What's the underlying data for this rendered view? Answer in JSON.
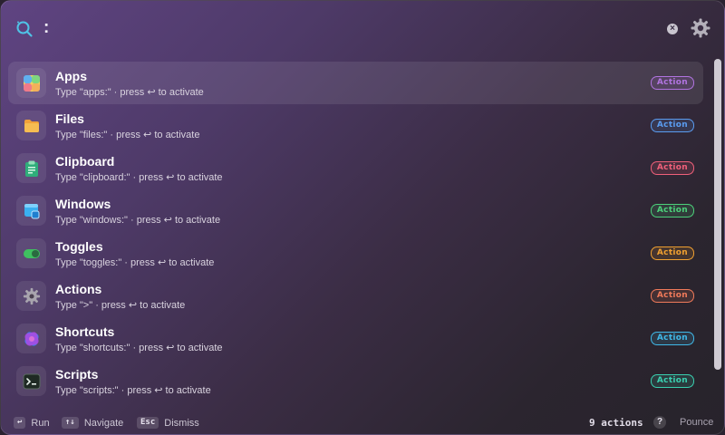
{
  "search": {
    "query": ":",
    "search_icon": "search-icon",
    "clear_icon": "close-icon",
    "clear_glyph": "×",
    "settings_icon": "gear-icon"
  },
  "items": [
    {
      "title": "Apps",
      "hint": "Type \"apps:\" · press ↩ to activate",
      "badge": "Action",
      "badge_color": "#b174e0",
      "icon": "apps-icon",
      "selected": true
    },
    {
      "title": "Files",
      "hint": "Type \"files:\" · press ↩ to activate",
      "badge": "Action",
      "badge_color": "#5a9cf0",
      "icon": "folder-icon",
      "selected": false
    },
    {
      "title": "Clipboard",
      "hint": "Type \"clipboard:\" · press ↩ to activate",
      "badge": "Action",
      "badge_color": "#f0607a",
      "icon": "clipboard-icon",
      "selected": false
    },
    {
      "title": "Windows",
      "hint": "Type \"windows:\" · press ↩ to activate",
      "badge": "Action",
      "badge_color": "#4cd07a",
      "icon": "windows-icon",
      "selected": false
    },
    {
      "title": "Toggles",
      "hint": "Type \"toggles:\" · press ↩ to activate",
      "badge": "Action",
      "badge_color": "#f0a030",
      "icon": "toggle-icon",
      "selected": false
    },
    {
      "title": "Actions",
      "hint": "Type \">\" · press ↩ to activate",
      "badge": "Action",
      "badge_color": "#f07a5a",
      "icon": "gear-icon",
      "selected": false
    },
    {
      "title": "Shortcuts",
      "hint": "Type \"shortcuts:\" · press ↩ to activate",
      "badge": "Action",
      "badge_color": "#40b8e8",
      "icon": "shortcuts-icon",
      "selected": false
    },
    {
      "title": "Scripts",
      "hint": "Type \"scripts:\" · press ↩ to activate",
      "badge": "Action",
      "badge_color": "#3ad0b0",
      "icon": "terminal-icon",
      "selected": false
    }
  ],
  "footer": {
    "run_key": "↩",
    "run_label": "Run",
    "nav_key": "↑↓",
    "nav_label": "Navigate",
    "dismiss_key": "Esc",
    "dismiss_label": "Dismiss",
    "count": "9 actions",
    "help_glyph": "?",
    "brand": "Pounce"
  }
}
